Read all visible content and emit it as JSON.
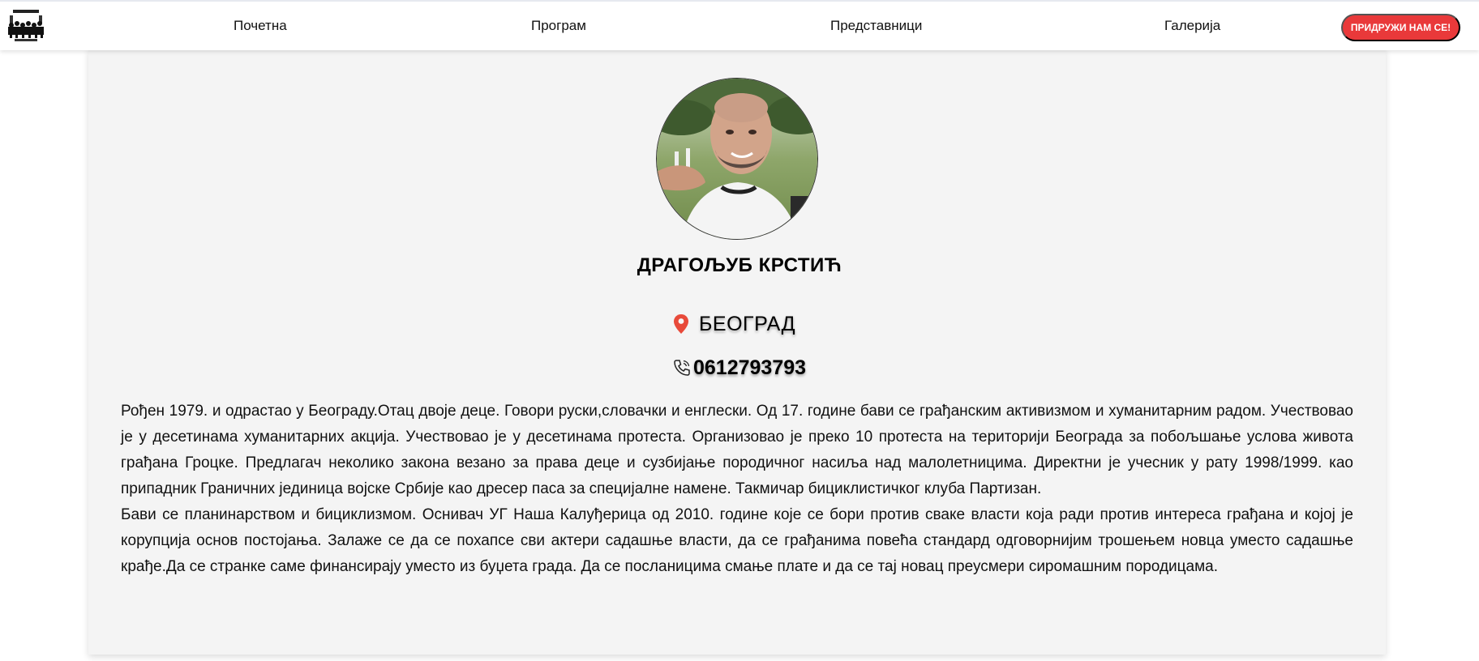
{
  "nav": {
    "logo": "logo",
    "items": [
      "Почетна",
      "Програм",
      "Представници",
      "Галерија"
    ],
    "cta_label": "ПРИДРУЖИ НАМ СЕ!",
    "cta_color": "#e9393a"
  },
  "profile": {
    "name": "ДРАГОЉУБ КРСТИЋ",
    "city_icon": "location-pin-icon",
    "city": "БЕОГРАД",
    "phone_icon": "phone-icon",
    "phone": "0612793793",
    "bio": [
      "Рођен 1979. и одрастао у Београду.Отац двоје деце. Говори руски,словачки и енглески. Од 17. године бави се грађанским активизмом и хуманитарним радом. Учествовао је у десетинама хуманитарних акција. Учествовао је у десетинама протеста. Организовао је преко 10 протеста на територији Београда за побољшање услова живота грађана Гроцке. Предлагач неколико закона везано за права деце и сузбијање породичног насиља над малолетницима. Директни је учесник у рату 1998/1999. као припадник Граничних јединица војске Србије као дресер паса за специјалне намене. Такмичар бициклистичког клуба Партизан.",
      "Бави се планинарством и бициклизмом. Оснивач УГ Наша Калуђерица од 2010. године које се бори против сваке власти која ради против интереса грађана и којој је корупција основ постојања. Залаже се да се похапсе сви актери садашње власти, да се грађанима повећа стандард одговорнијим трошењем новца уместо садашње крађе.Да се странке саме финансирају уместо из буџета града. Да се посланицима смање плате и да се тај новац преусмери сиромашним породицама."
    ]
  }
}
